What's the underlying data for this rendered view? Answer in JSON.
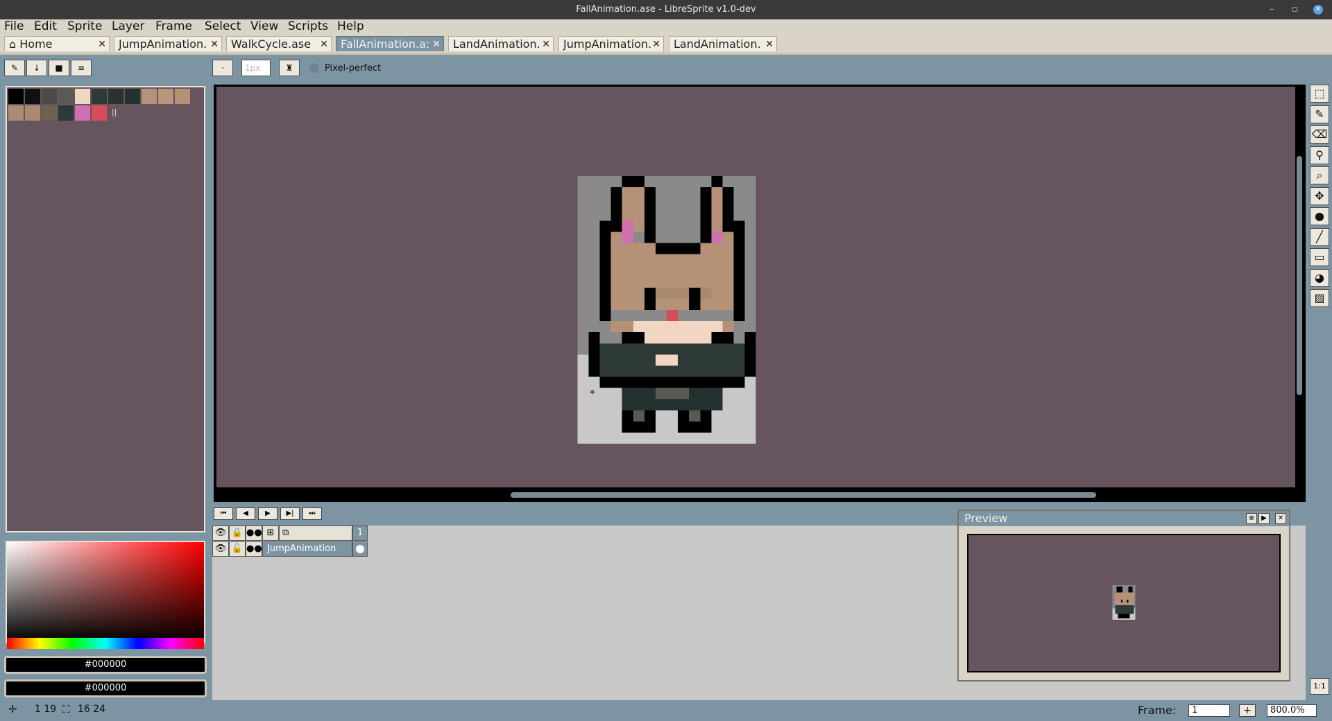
{
  "window": {
    "title": "FallAnimation.ase - LibreSprite v1.0-dev",
    "controls": [
      "–",
      "▫",
      "✕"
    ]
  },
  "menu": [
    "File",
    "Edit",
    "Sprite",
    "Layer",
    "Frame",
    "Select",
    "View",
    "Scripts",
    "Help"
  ],
  "tabs": [
    {
      "label": "Home",
      "close": "✕"
    },
    {
      "label": "JumpAnimation.",
      "close": "✕"
    },
    {
      "label": "WalkCycle.ase",
      "close": "✕"
    },
    {
      "label": "FallAnimation.a:",
      "close": "✕"
    },
    {
      "label": "LandAnimation.",
      "close": "✕"
    },
    {
      "label": "JumpAnimation.",
      "close": "✕"
    },
    {
      "label": "LandAnimation.",
      "close": "✕"
    }
  ],
  "toolbar": {
    "brush_size": "1px",
    "pixel_perfect_label": "Pixel-perfect"
  },
  "palette": {
    "colors": [
      "#000000",
      "#111111",
      "#4a4a46",
      "#5a5a55",
      "#f2d6c4",
      "#2e3a35",
      "#2a3330",
      "#253030",
      "#b5937a",
      "#b8957b",
      "#b59277",
      "#a98c72",
      "#a88a70",
      "#6e6150",
      "#2b3a36",
      "#d070b0",
      "#d84b5a"
    ],
    "more_indicator": "||"
  },
  "colors": {
    "foreground": "#000000",
    "background": "#000000"
  },
  "timeline": {
    "frame_header": "1",
    "layer_name": "JumpAnimation"
  },
  "preview": {
    "title": "Preview"
  },
  "status": {
    "cursor": "1 19",
    "size": "16 24",
    "frame_label": "Frame:",
    "frame_value": "1",
    "zoom": "800.0%",
    "add_frame": "+",
    "one_to_one": "1:1"
  },
  "accent": "#7d94a3",
  "canvas_bg": "#66555f"
}
